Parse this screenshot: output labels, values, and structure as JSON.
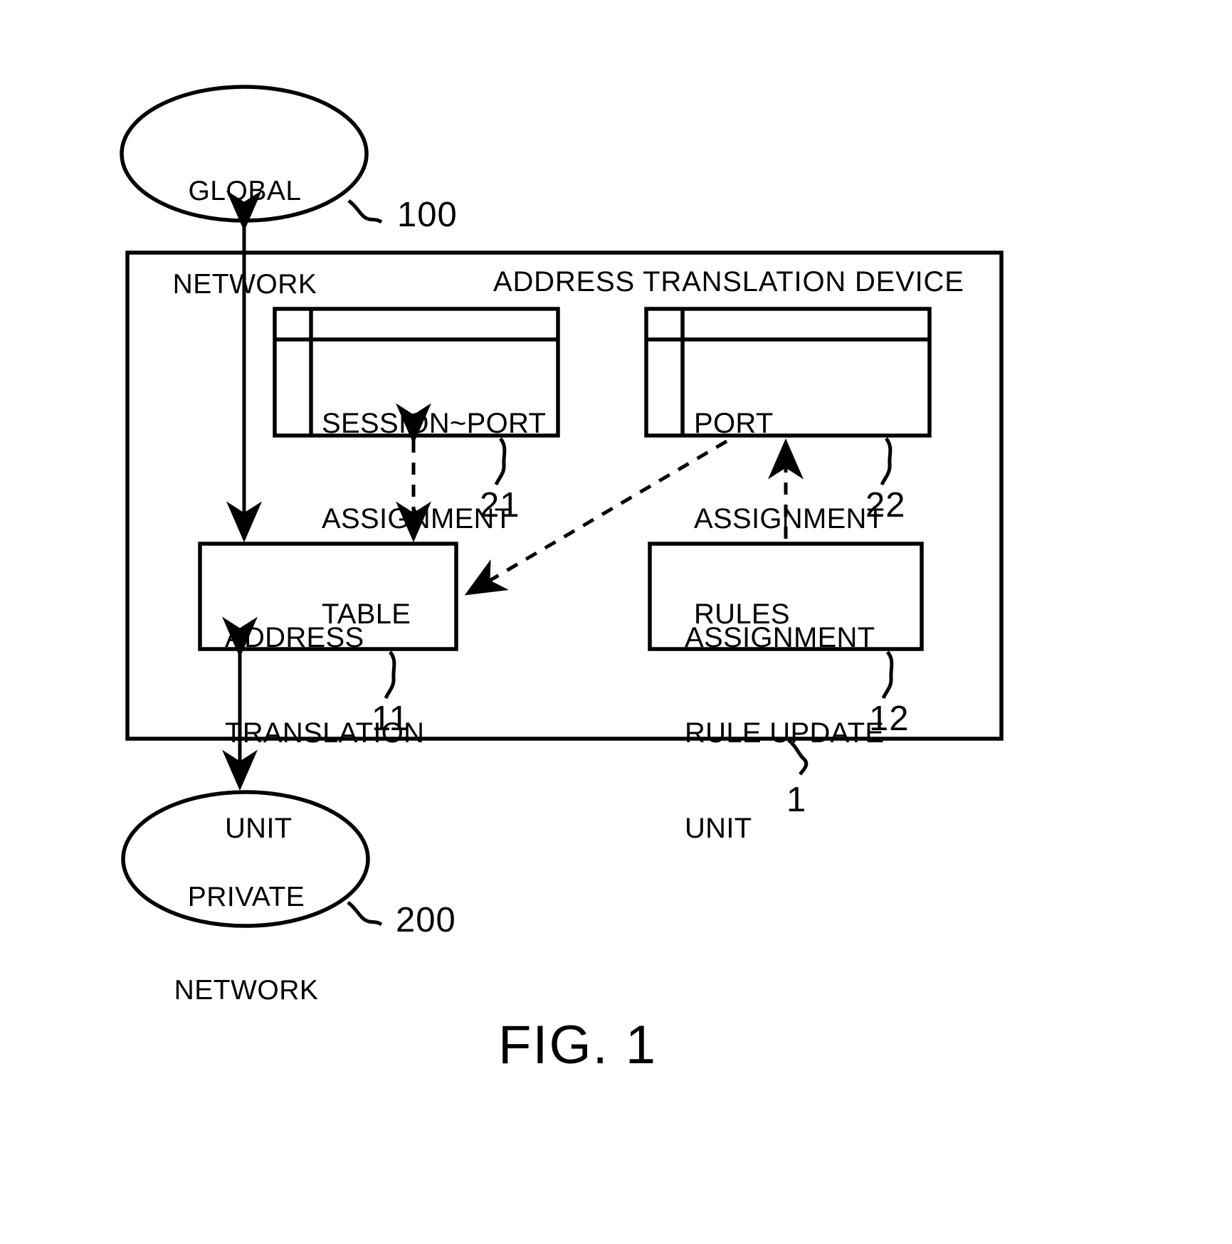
{
  "figure": {
    "caption": "FIG. 1",
    "device_title": "ADDRESS TRANSLATION DEVICE",
    "device_ref": "1"
  },
  "nodes": {
    "global_network": {
      "line1": "GLOBAL",
      "line2": "NETWORK",
      "ref": "100"
    },
    "private_network": {
      "line1": "PRIVATE",
      "line2": "NETWORK",
      "ref": "200"
    },
    "session_port_table": {
      "line1": "SESSION~PORT",
      "line2": "ASSIGNMENT",
      "line3": "TABLE",
      "ref": "21"
    },
    "port_assignment_rules": {
      "line1": "PORT",
      "line2": "ASSIGNMENT",
      "line3": "RULES",
      "ref": "22"
    },
    "address_translation_unit": {
      "line1": "ADDRESS",
      "line2": "TRANSLATION",
      "line3": "UNIT",
      "ref": "11"
    },
    "assignment_rule_update_unit": {
      "line1": "ASSIGNMENT",
      "line2": "RULE UPDATE",
      "line3": "UNIT",
      "ref": "12"
    }
  },
  "colors": {
    "ink": "#000000",
    "paper": "#ffffff"
  }
}
